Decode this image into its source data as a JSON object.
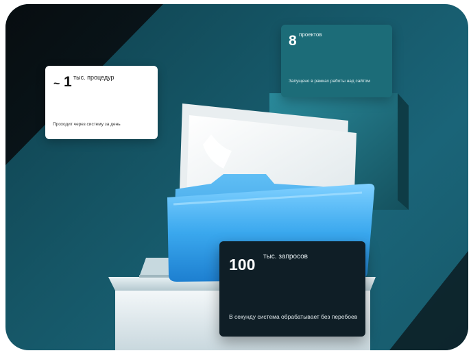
{
  "stats": [
    {
      "prefix": "~",
      "value": "1",
      "unit": "тыс. процедур",
      "description": "Проходит через систему за день"
    },
    {
      "value": "8",
      "unit": "проектов",
      "description": "Запущено в рамках работы над сайтом"
    },
    {
      "value": "100",
      "unit": "тыс. запросов",
      "description": "В секунду  система обрабатывает без перебоев"
    }
  ],
  "colors": {
    "background": "#155565",
    "card_teal": "#1c6c78",
    "card_dark": "#0f1e26",
    "card_white": "#ffffff",
    "folder_blue": "#3aa8ee"
  },
  "illustration": {
    "icon": "folder-with-documents-icon",
    "pedestal": "pedestal-icon"
  }
}
